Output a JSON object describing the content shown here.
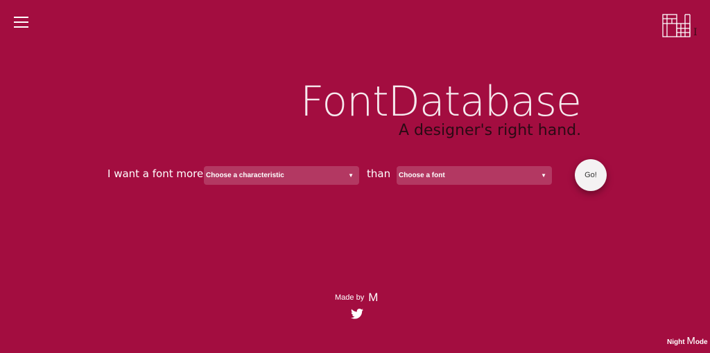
{
  "header": {
    "logo_text": "FdI"
  },
  "hero": {
    "title": "FontDatabase",
    "subtitle": "A designer's right hand."
  },
  "search": {
    "prefix": "I want a font more",
    "characteristic_select": "Choose a characteristic",
    "middle": "than",
    "font_select": "Choose a font",
    "go_label": "Go!"
  },
  "footer": {
    "made_by": "Made by",
    "maker_mark": "M",
    "night_prefix": "Night ",
    "night_m": "M",
    "night_suffix": "ode"
  }
}
